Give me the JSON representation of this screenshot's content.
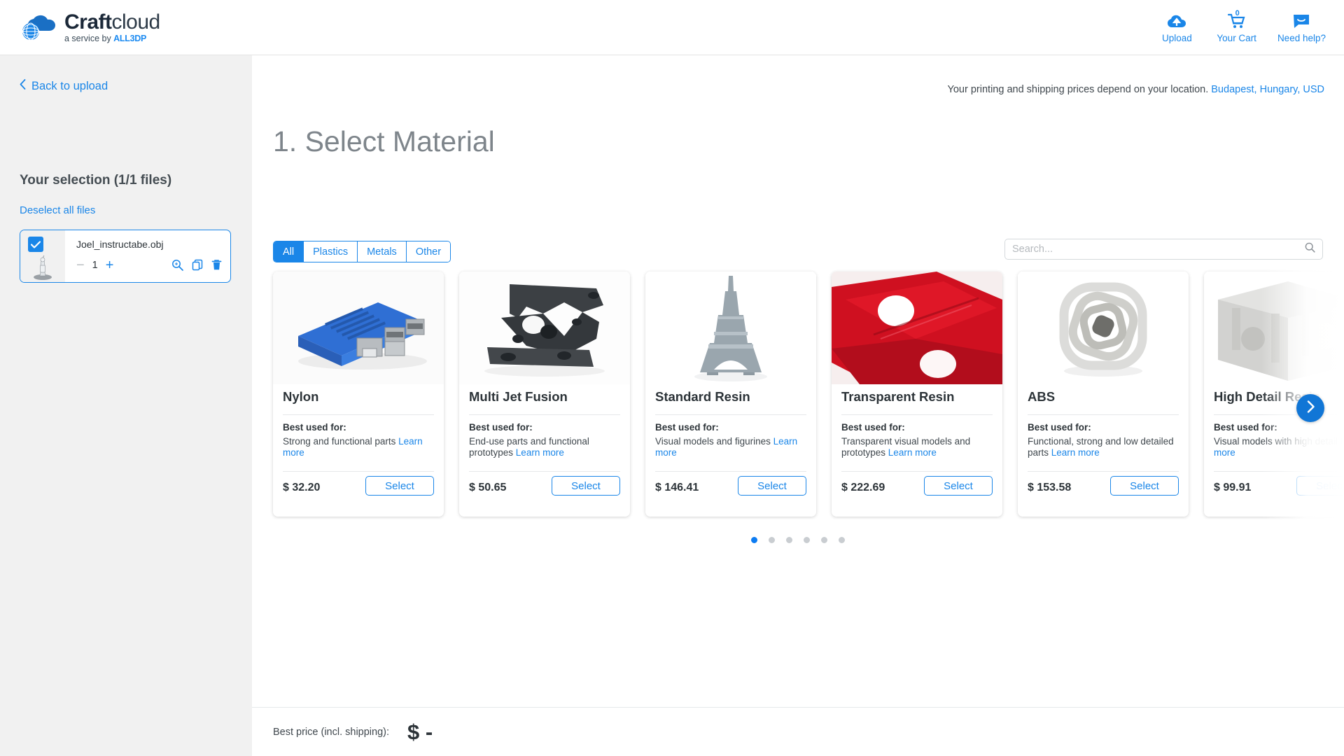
{
  "header": {
    "logo": {
      "name_bold": "Craft",
      "name_light": "cloud",
      "tagline_prefix": "a service by ",
      "tagline_brand": "ALL3DP"
    },
    "actions": [
      {
        "icon": "cloud-upload-icon",
        "label": "Upload"
      },
      {
        "icon": "shopping-cart-icon",
        "label": "Your Cart",
        "badge": "0"
      },
      {
        "icon": "chat-bubble-icon",
        "label": "Need help?"
      }
    ]
  },
  "sidebar": {
    "back_link": "Back to upload",
    "selection_title": "Your selection (1/1 files)",
    "deselect_all": "Deselect all files",
    "file": {
      "name": "Joel_instructabe.obj",
      "quantity": "1",
      "decrement": "−",
      "increment": "+",
      "tools": [
        "magnify-icon",
        "duplicate-icon",
        "trash-icon"
      ]
    }
  },
  "main": {
    "location_notice": "Your printing and shipping prices depend on your location.",
    "location_link": "Budapest, Hungary, USD",
    "page_title": "1. Select Material",
    "filters": [
      {
        "label": "All",
        "active": true
      },
      {
        "label": "Plastics",
        "active": false
      },
      {
        "label": "Metals",
        "active": false
      },
      {
        "label": "Other",
        "active": false
      }
    ],
    "search": {
      "value": "",
      "placeholder": "Search..."
    },
    "materials": [
      {
        "name": "Nylon",
        "best_used_label": "Best used for:",
        "description": "Strong and functional parts ",
        "learn_more": "Learn more",
        "price": "$ 32.20",
        "select_label": "Select",
        "image": "nylon-case-photo"
      },
      {
        "name": "Multi Jet Fusion",
        "best_used_label": "Best used for:",
        "description": "End-use parts and functional prototypes ",
        "learn_more": "Learn more",
        "price": "$ 50.65",
        "select_label": "Select",
        "image": "mjf-bracket-photo"
      },
      {
        "name": "Standard Resin",
        "best_used_label": "Best used for:",
        "description": "Visual models and figurines ",
        "learn_more": "Learn more",
        "price": "$ 146.41",
        "select_label": "Select",
        "image": "eiffel-tower-photo"
      },
      {
        "name": "Transparent Resin",
        "best_used_label": "Best used for:",
        "description": "Transparent visual models and prototypes ",
        "learn_more": "Learn more",
        "price": "$ 222.69",
        "select_label": "Select",
        "image": "red-translucent-photo"
      },
      {
        "name": "ABS",
        "best_used_label": "Best used for:",
        "description": "Functional, strong and low detailed parts ",
        "learn_more": "Learn more",
        "price": "$ 153.58",
        "select_label": "Select",
        "image": "white-gyroid-photo"
      },
      {
        "name": "High Detail Resin",
        "best_used_label": "Best used for:",
        "description": "Visual models with high detail ",
        "learn_more": "Learn more",
        "price": "$ 99.91",
        "select_label": "Select",
        "image": "gray-lattice-photo"
      }
    ],
    "carousel": {
      "dots": 6,
      "active_dot": 0,
      "next_icon": "chevron-right-icon"
    }
  },
  "footer": {
    "best_price_label": "Best price (incl. shipping):",
    "best_price_value": "$ -"
  },
  "colors": {
    "accent": "#1a86e8",
    "accent_dark": "#1176d6",
    "sidebar_bg": "#f1f1f1",
    "text": "#2c3338",
    "muted": "#7e858b"
  }
}
